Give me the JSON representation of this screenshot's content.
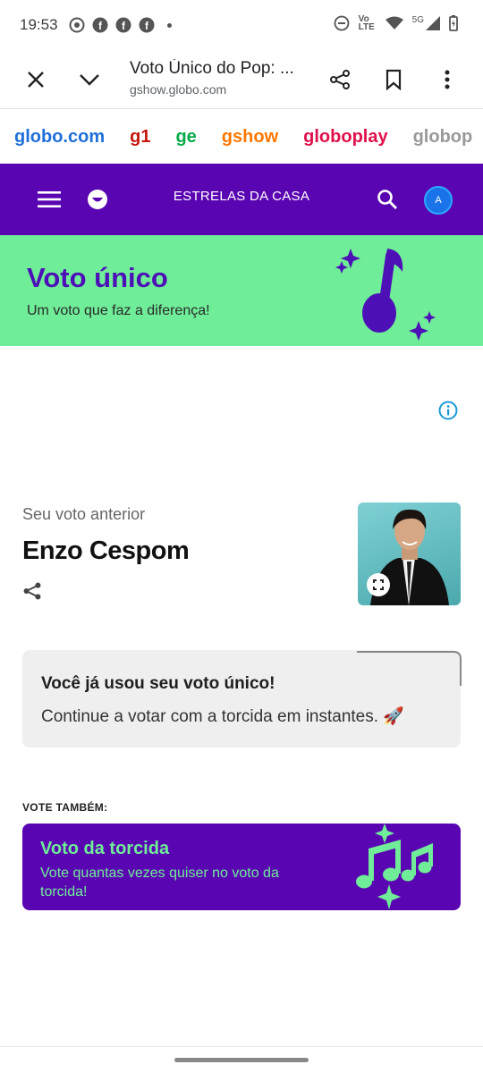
{
  "status": {
    "time": "19:53",
    "network_label": "5G",
    "lte_label": "Vo LTE"
  },
  "browser": {
    "title": "Voto Único do Pop: ...",
    "url": "gshow.globo.com"
  },
  "brands": [
    {
      "label": "globo.com",
      "color": "#1e6fd9"
    },
    {
      "label": "g1",
      "color": "#c4170c"
    },
    {
      "label": "ge",
      "color": "#06aa48"
    },
    {
      "label": "gshow",
      "color": "#ff7700"
    },
    {
      "label": "globoplay",
      "color": "#e0104a"
    },
    {
      "label": "globop",
      "color": "#999999"
    }
  ],
  "navbar": {
    "title": "ESTRELAS DA CASA",
    "avatar_letter": "A"
  },
  "banner": {
    "title": "Voto único",
    "subtitle": "Um voto que faz a diferença!"
  },
  "previous_vote": {
    "label": "Seu voto anterior",
    "name": "Enzo Cespom"
  },
  "notice": {
    "title": "Você já usou seu voto único!",
    "message": "Continue a votar com a torcida em instantes. 🚀"
  },
  "vote_also": {
    "label": "VOTE TAMBÉM:",
    "card_title": "Voto da torcida",
    "card_text": "Vote quantas vezes quiser no voto da torcida!"
  },
  "colors": {
    "primary_purple": "#5a05b2",
    "accent_green": "#6fed98"
  }
}
